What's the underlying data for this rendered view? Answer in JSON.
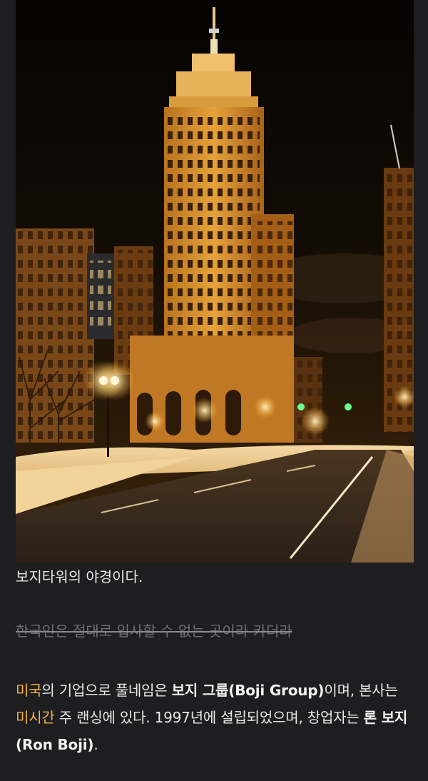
{
  "photo": {
    "description_icon": "night-building-photo"
  },
  "caption": "보지타워의 야경이다.",
  "struck_text": "한국인은 절대로 입사할 수 없는 곳이라 카더라",
  "paragraph": {
    "seg1_hl": "미국",
    "seg2": "의 기업으로 풀네임은 ",
    "seg3_bold": "보지 그룹(Boji Group)",
    "seg4": "이며, 본사는 ",
    "seg5_hl": "미시간",
    "seg6": " 주 랜싱에 있다. 1997년에 설립되었으며, 창업자는 ",
    "seg7_bold": "론 보지(Ron Boji)",
    "seg8": "."
  },
  "colors": {
    "background": "#1e1e20",
    "highlight": "#f0b43c",
    "text": "#e8e8e8",
    "muted": "#6e6e72"
  }
}
